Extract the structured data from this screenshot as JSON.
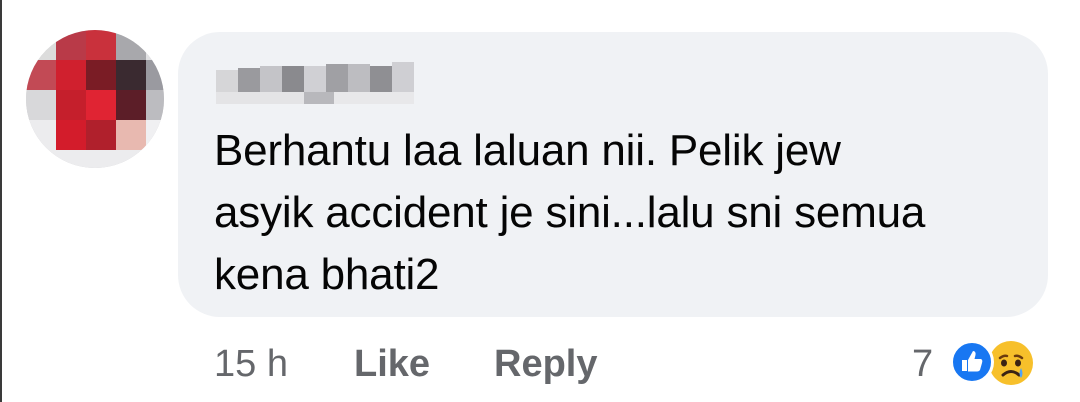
{
  "comment": {
    "text": "Berhantu laa laluan nii. Pelik jew\nasyik accident je sini...lalu sni semua\nkena bhati2"
  },
  "actions": {
    "time": "15 h",
    "like_label": "Like",
    "reply_label": "Reply"
  },
  "reactions": {
    "count": "7",
    "icons": [
      "like-icon",
      "sad-icon"
    ]
  },
  "colors": {
    "bubble": "#f0f2f5",
    "text": "#050505",
    "secondary": "#65676b",
    "like_blue": "#1877f2",
    "sad_yellow": "#f7b125"
  }
}
